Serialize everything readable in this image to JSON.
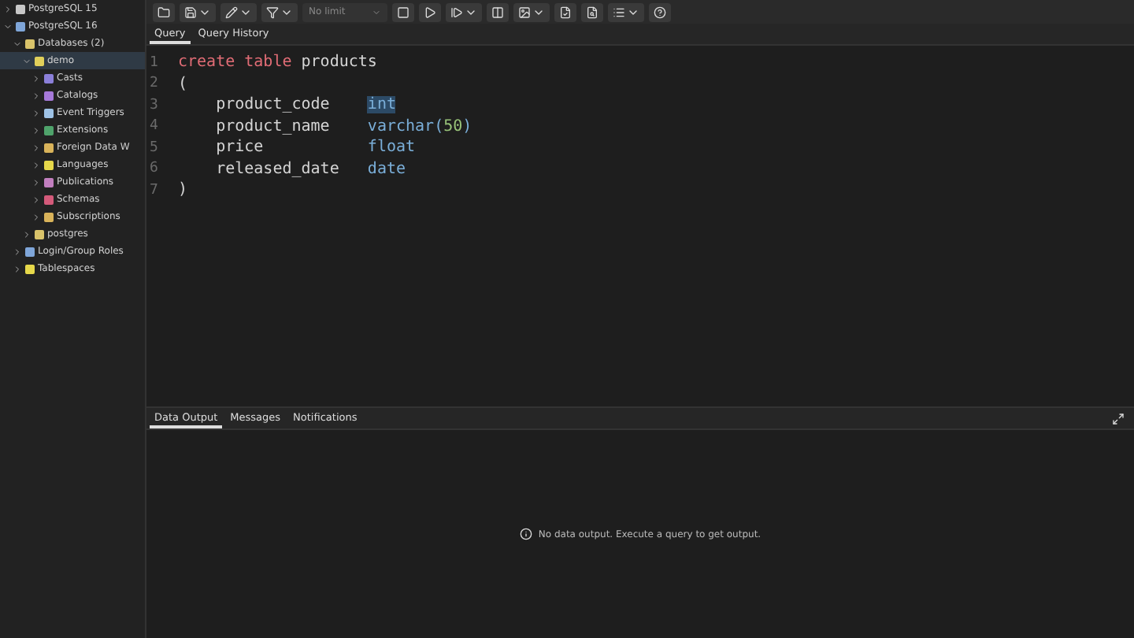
{
  "tree": [
    {
      "label": "PostgreSQL 15",
      "expanded": false,
      "selected": false,
      "color": "#c8c8c8"
    },
    {
      "label": "PostgreSQL 16",
      "expanded": true,
      "selected": false,
      "color": "#7fa6d9",
      "children": [
        {
          "label": "Databases (2)",
          "expanded": true,
          "selected": false,
          "color": "#d9c36a",
          "children": [
            {
              "label": "demo",
              "expanded": true,
              "selected": true,
              "color": "#e0cf5a",
              "children": [
                {
                  "label": "Casts",
                  "expanded": false,
                  "selected": false,
                  "color": "#8b7fd9"
                },
                {
                  "label": "Catalogs",
                  "expanded": false,
                  "selected": false,
                  "color": "#a679d9"
                },
                {
                  "label": "Event Triggers",
                  "expanded": false,
                  "selected": false,
                  "color": "#9fc3e6"
                },
                {
                  "label": "Extensions",
                  "expanded": false,
                  "selected": false,
                  "color": "#4fa36b"
                },
                {
                  "label": "Foreign Data W",
                  "expanded": false,
                  "selected": false,
                  "color": "#d9b35a"
                },
                {
                  "label": "Languages",
                  "expanded": false,
                  "selected": false,
                  "color": "#e6d84a"
                },
                {
                  "label": "Publications",
                  "expanded": false,
                  "selected": false,
                  "color": "#c27fbf"
                },
                {
                  "label": "Schemas",
                  "expanded": false,
                  "selected": false,
                  "color": "#d45a7a"
                },
                {
                  "label": "Subscriptions",
                  "expanded": false,
                  "selected": false,
                  "color": "#d9b35a"
                }
              ]
            },
            {
              "label": "postgres",
              "expanded": false,
              "selected": false,
              "color": "#d9c36a"
            }
          ]
        },
        {
          "label": "Login/Group Roles",
          "expanded": false,
          "selected": false,
          "color": "#7fa6d9"
        },
        {
          "label": "Tablespaces",
          "expanded": false,
          "selected": false,
          "color": "#e6d84a"
        }
      ]
    }
  ],
  "toolbar": {
    "row_limit": "No limit"
  },
  "editor_tabs": [
    {
      "label": "Query",
      "selected": true
    },
    {
      "label": "Query History",
      "selected": false
    }
  ],
  "code_lines": [
    {
      "number": "1",
      "tokens": [
        {
          "text": "create table",
          "kind": "keyword",
          "highlighted": false
        },
        {
          "text": " products",
          "kind": "ident",
          "highlighted": false
        }
      ]
    },
    {
      "number": "2",
      "tokens": [
        {
          "text": "(",
          "kind": "punct",
          "highlighted": false
        }
      ]
    },
    {
      "number": "3",
      "tokens": [
        {
          "text": "    product_code    ",
          "kind": "ident",
          "highlighted": false
        },
        {
          "text": "int",
          "kind": "type",
          "highlighted": true
        }
      ]
    },
    {
      "number": "4",
      "tokens": [
        {
          "text": "    product_name    ",
          "kind": "ident",
          "highlighted": false
        },
        {
          "text": "varchar(",
          "kind": "type",
          "highlighted": false
        },
        {
          "text": "50",
          "kind": "number",
          "highlighted": false
        },
        {
          "text": ")",
          "kind": "type",
          "highlighted": false
        }
      ]
    },
    {
      "number": "5",
      "tokens": [
        {
          "text": "    price           ",
          "kind": "ident",
          "highlighted": false
        },
        {
          "text": "float",
          "kind": "type",
          "highlighted": false
        }
      ]
    },
    {
      "number": "6",
      "tokens": [
        {
          "text": "    released_date   ",
          "kind": "ident",
          "highlighted": false
        },
        {
          "text": "date",
          "kind": "type",
          "highlighted": false
        }
      ]
    },
    {
      "number": "7",
      "tokens": [
        {
          "text": ")",
          "kind": "punct",
          "highlighted": false
        }
      ]
    }
  ],
  "output_tabs": [
    {
      "label": "Data Output",
      "selected": true
    },
    {
      "label": "Messages",
      "selected": false
    },
    {
      "label": "Notifications",
      "selected": false
    }
  ],
  "output_message": "No data output. Execute a query to get output."
}
